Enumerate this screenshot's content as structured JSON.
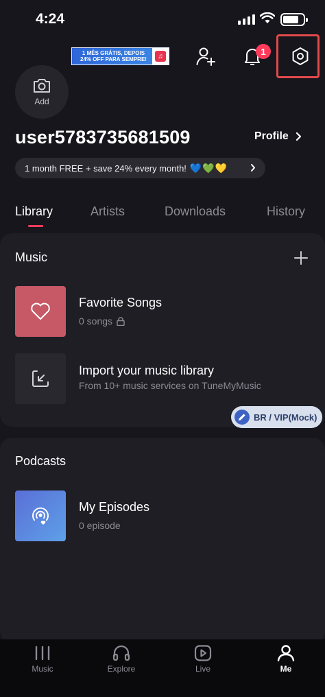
{
  "status_bar": {
    "time": "4:24"
  },
  "header": {
    "promo_banner": {
      "line1": "1 MÊS GRÁTIS, DEPOIS",
      "line2": "24% OFF PARA SEMPRE!",
      "logo_letter": "♫"
    },
    "notification_count": "1",
    "icons": [
      "add-friend-icon",
      "bell-icon",
      "settings-icon"
    ]
  },
  "profile": {
    "avatar_label": "Add",
    "username": "user5783735681509",
    "profile_link": "Profile",
    "promo_pill": "1 month FREE + save 24% every month!",
    "promo_hearts": [
      "💙",
      "💚",
      "💛"
    ]
  },
  "tabs": [
    {
      "label": "Library",
      "active": true
    },
    {
      "label": "Artists",
      "active": false
    },
    {
      "label": "Downloads",
      "active": false
    },
    {
      "label": "History",
      "active": false
    }
  ],
  "music": {
    "title": "Music",
    "items": [
      {
        "title": "Favorite Songs",
        "subtitle": "0 songs",
        "icon": "heart-icon"
      },
      {
        "title": "Import your music library",
        "subtitle": "From 10+ music services on TuneMyMusic",
        "icon": "import-icon"
      }
    ],
    "vip_badge": "BR / VIP(Mock)"
  },
  "podcasts": {
    "title": "Podcasts",
    "items": [
      {
        "title": "My Episodes",
        "subtitle": "0 episode",
        "icon": "podcast-heart-icon"
      }
    ]
  },
  "bottom_nav": [
    {
      "label": "Music",
      "icon": "bars-icon",
      "active": false
    },
    {
      "label": "Explore",
      "icon": "headphones-icon",
      "active": false
    },
    {
      "label": "Live",
      "icon": "play-icon",
      "active": false
    },
    {
      "label": "Me",
      "icon": "person-icon",
      "active": true
    }
  ],
  "colors": {
    "background": "#17161c",
    "card": "#1f1e25",
    "accent": "#ff3b5c",
    "settings_highlight": "#e24a4a"
  }
}
